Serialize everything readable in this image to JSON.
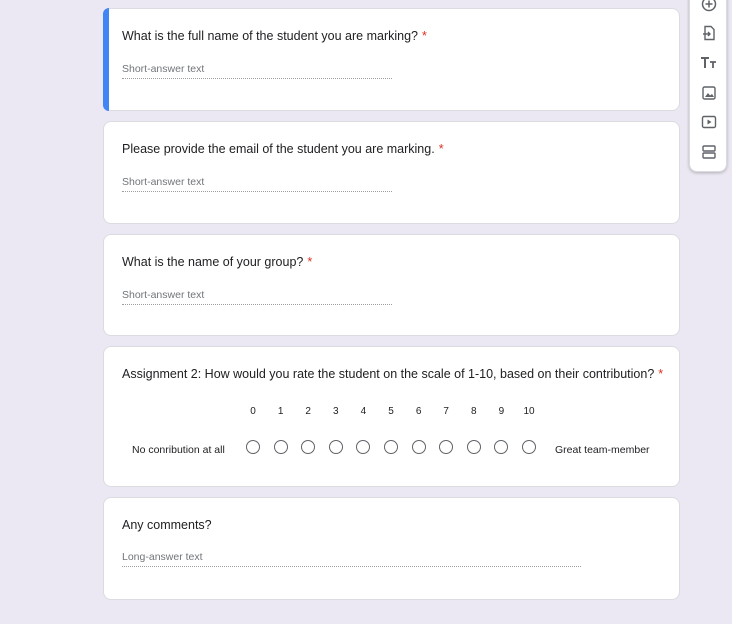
{
  "questions": [
    {
      "title": "What is the full name of the student you are marking?",
      "required": "*",
      "placeholder": "Short-answer text"
    },
    {
      "title": "Please provide the email of the student you are marking.",
      "required": "*",
      "placeholder": "Short-answer text"
    },
    {
      "title": "What is the name of your group?",
      "required": "*",
      "placeholder": "Short-answer text"
    },
    {
      "title": "Assignment 2: How would you rate the student on the scale of 1-10, based on their contribution?",
      "required": "*",
      "scale": {
        "numbers": [
          "0",
          "1",
          "2",
          "3",
          "4",
          "5",
          "6",
          "7",
          "8",
          "9",
          "10"
        ],
        "min_label": "No conribution at all",
        "max_label": "Great team-member"
      }
    },
    {
      "title": "Any comments?",
      "placeholder": "Long-answer text"
    }
  ],
  "toolbar": {
    "icons": [
      "add-question-icon",
      "import-questions-icon",
      "add-title-icon",
      "add-image-icon",
      "add-video-icon",
      "add-section-icon"
    ]
  },
  "colors": {
    "accent": "#4285f4",
    "required": "#d93025",
    "background": "#ece8f3"
  }
}
